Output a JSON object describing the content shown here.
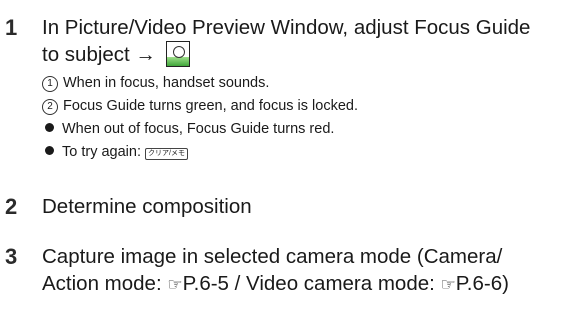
{
  "steps": [
    {
      "number": "1",
      "line1": "In Picture/Video Preview Window, adjust Focus Guide",
      "line2_prefix": "to subject →",
      "line2_icon": "camera-shutter-key-icon",
      "notes": [
        {
          "marker": "1",
          "text": "When in focus, handset sounds."
        },
        {
          "marker": "2",
          "text": "Focus Guide turns green, and focus is locked."
        }
      ],
      "bullets": [
        {
          "text": "When out of focus, Focus Guide turns red."
        },
        {
          "text": "To try again:",
          "key_label": "クリア/メモ",
          "key_icon": "clear-memo-key-icon"
        }
      ]
    },
    {
      "number": "2",
      "line1": "Determine composition"
    },
    {
      "number": "3",
      "line1": "Capture image in selected camera mode (Camera/",
      "line2_a": "Action mode: ",
      "line2_b": "P.6-5 / Video camera mode: ",
      "line2_c": "P.6-6)",
      "ref_glyph": "☞"
    }
  ]
}
